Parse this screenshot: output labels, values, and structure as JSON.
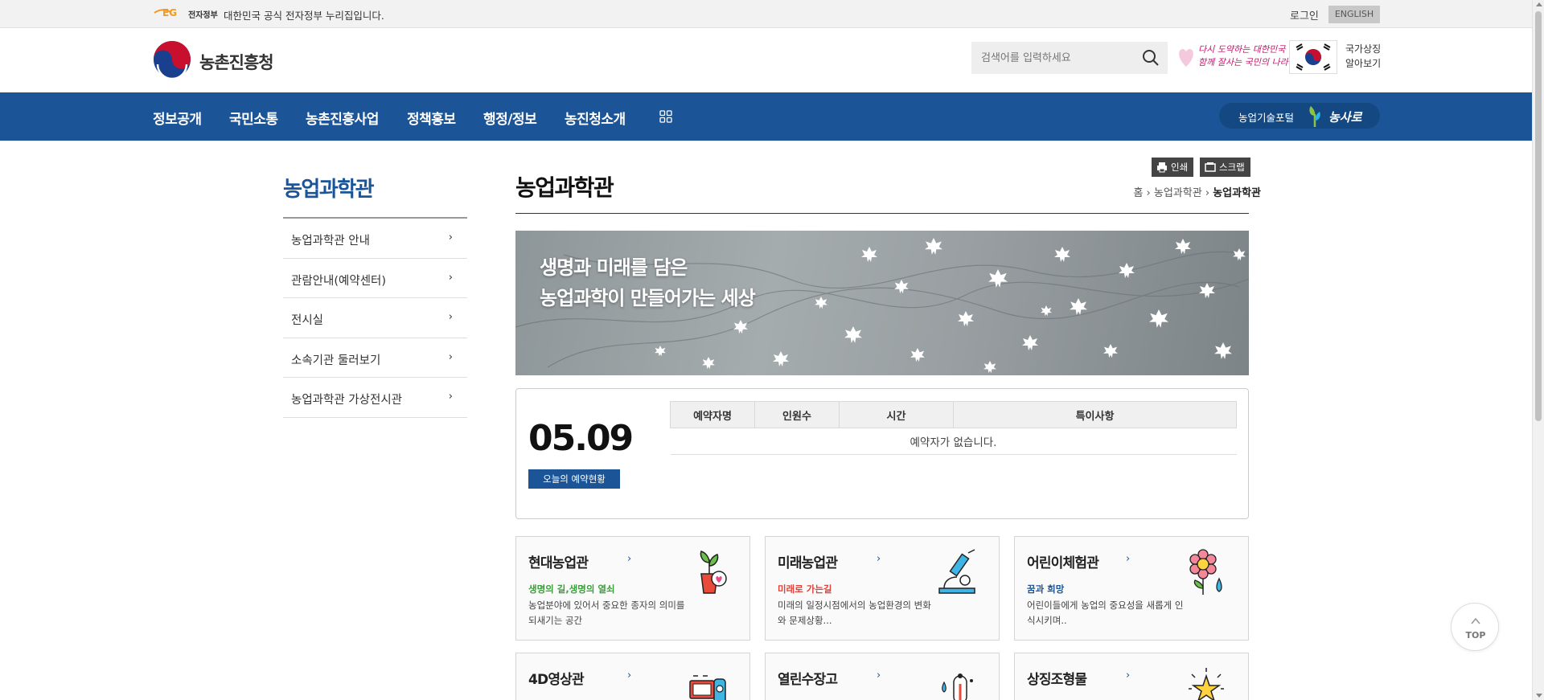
{
  "govbar": {
    "eg_label": "전자정부",
    "notice": "대한민국 공식 전자정부 누리집입니다.",
    "login": "로그인",
    "english": "ENGLISH"
  },
  "header": {
    "logo_text": "농촌진흥청",
    "search_placeholder": "검색어를 입력하세요",
    "slogan_line1": "다시 도약하는 대한민국",
    "slogan_line2": "함께 잘사는 국민의 나라",
    "national_line1": "국가상징",
    "national_line2": "알아보기"
  },
  "nav": {
    "items": [
      "정보공개",
      "국민소통",
      "농촌진흥사업",
      "정책홍보",
      "행정/정보",
      "농진청소개"
    ],
    "portal_label": "농업기술포털",
    "portal_brand": "농사로"
  },
  "sidebar": {
    "title": "농업과학관",
    "items": [
      "농업과학관 안내",
      "관람안내(예약센터)",
      "전시실",
      "소속기관 둘러보기",
      "농업과학관 가상전시관"
    ]
  },
  "content": {
    "page_title": "농업과학관",
    "print_label": "인쇄",
    "scrap_label": "스크랩",
    "breadcrumb": [
      "홈",
      "농업과학관",
      "농업과학관"
    ],
    "banner_line1": "생명과 미래를 담은",
    "banner_line2": "농업과학이 만들어가는 세상"
  },
  "reservation": {
    "date": "05.09",
    "today_label": "오늘의 예약현황",
    "columns": [
      "예약자명",
      "인원수",
      "시간",
      "특이사항"
    ],
    "empty_message": "예약자가 없습니다."
  },
  "cards": [
    {
      "title": "현대농업관",
      "subtitle": "생명의 길,생명의 열쇠",
      "subtitle_color": "#3aa03a",
      "desc": "농업분야에 있어서 중요한 종자의 의미를 되새기는 공간",
      "icon": "plant-pot-icon"
    },
    {
      "title": "미래농업관",
      "subtitle": "미래로 가는길",
      "subtitle_color": "#e0423a",
      "desc": "미래의 일정시점에서의 농업환경의 변화와 문제상황...",
      "icon": "microscope-icon"
    },
    {
      "title": "어린이체험관",
      "subtitle": "꿈과 희망",
      "subtitle_color": "#1b5597",
      "desc": "어린이들에게 농업의 중요성을 새롭게 인식시키며..",
      "icon": "flower-icon"
    },
    {
      "title": "4D영상관",
      "icon": "projector-icon"
    },
    {
      "title": "열린수장고",
      "icon": "thermometer-icon"
    },
    {
      "title": "상징조형물",
      "icon": "star-icon"
    }
  ],
  "top_button": "TOP",
  "colors": {
    "primary": "#1b5597",
    "nav_bg": "#1b5597"
  }
}
